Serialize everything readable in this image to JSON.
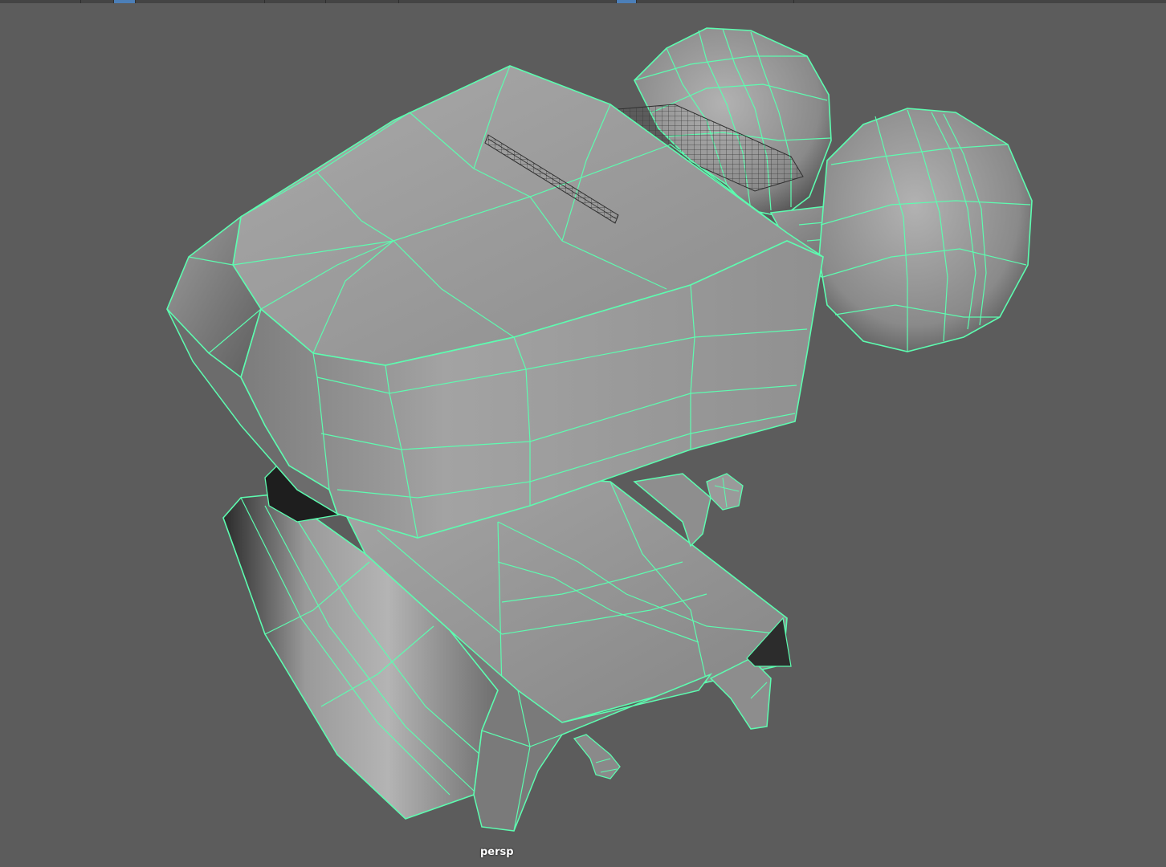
{
  "viewport": {
    "camera_label": "persp",
    "background_color": "#5c5c5c",
    "wireframe_color": "#5dfcb0",
    "mesh_shading": "smooth-grey",
    "selected_object": "turret-mesh"
  },
  "toolbar": {
    "segments": [
      {
        "name": "panel-menu-view",
        "active": false
      },
      {
        "name": "panel-menu-shading",
        "active": false
      },
      {
        "name": "panel-menu-lighting",
        "active": true
      },
      {
        "name": "panel-menu-show",
        "active": false
      },
      {
        "name": "panel-menu-renderer",
        "active": false
      },
      {
        "name": "panel-menu-panels",
        "active": false
      },
      {
        "name": "panel-tool-isolate",
        "active": true
      },
      {
        "name": "panel-tool-grid",
        "active": false
      }
    ]
  }
}
